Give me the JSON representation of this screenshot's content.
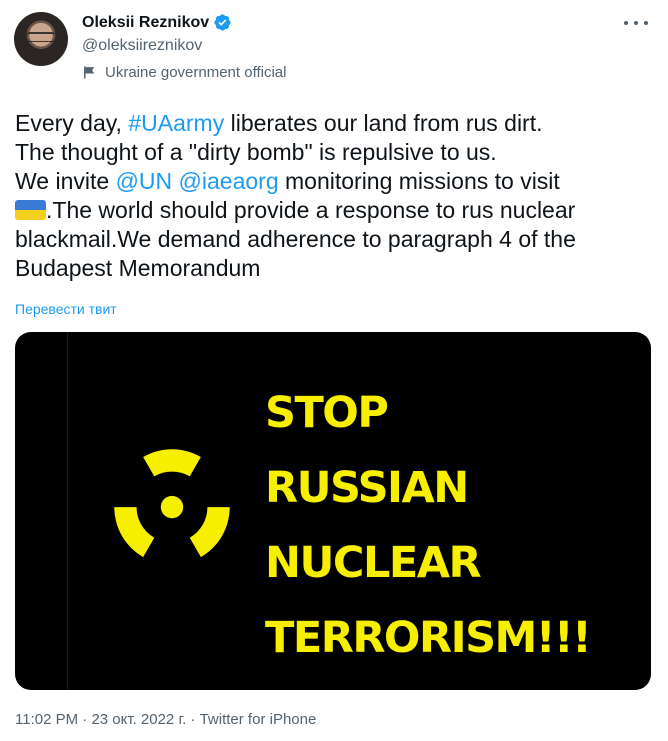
{
  "author": {
    "name": "Oleksii Reznikov",
    "handle": "@oleksiireznikov",
    "label": "Ukraine government official"
  },
  "tweet": {
    "line1_before": "Every day, ",
    "hashtag": "#UAarmy",
    "line1_after": " liberates our land from rus dirt.",
    "line2": "The thought of a \"dirty bomb\" is repulsive to us.",
    "line3_before": "We invite ",
    "mention_un": "@UN",
    "mention_iaea": "@iaeaorg",
    "line3_after": " monitoring missions to visit",
    "line4_after_flag": ".The world should provide a response to rus nuclear",
    "line5": "blackmail.We demand adherence to paragraph 4 of the",
    "line6": "Budapest Memorandum",
    "translate": "Перевести твит",
    "flag_emoji_name": "ukraine-flag-icon"
  },
  "media": {
    "lines": [
      "STOP",
      "RUSSIAN",
      "NUCLEAR",
      "TERRORISM!!!"
    ],
    "icon": "radiation-icon",
    "text_color": "#f7ef00",
    "background": "#000000"
  },
  "footer": {
    "time": "11:02 PM",
    "date": "23 окт. 2022 г.",
    "source": "Twitter for iPhone",
    "separator": " · "
  },
  "colors": {
    "link": "#1d9bf0",
    "secondary": "#536471",
    "verified": "#1d9bf0"
  }
}
